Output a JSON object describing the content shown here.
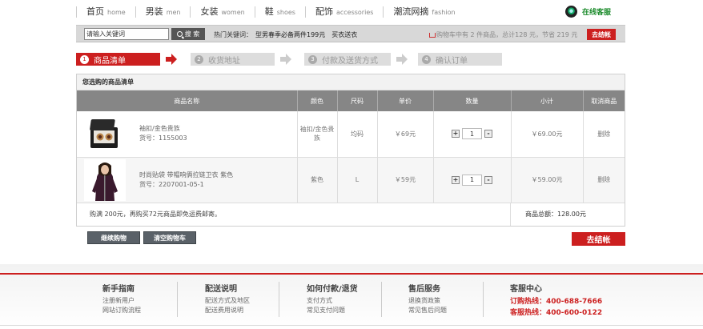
{
  "nav": {
    "items": [
      {
        "zh": "首页",
        "en": "home"
      },
      {
        "zh": "男装",
        "en": "men"
      },
      {
        "zh": "女装",
        "en": "women"
      },
      {
        "zh": "鞋",
        "en": "shoes"
      },
      {
        "zh": "配饰",
        "en": "accessories"
      },
      {
        "zh": "潮流网摘",
        "en": "fashion"
      }
    ],
    "online_service": "在线客服"
  },
  "search": {
    "value": "请输入关键词",
    "button": "搜 索",
    "hot_label": "热门关键词：",
    "hot_links": [
      "型男春季必备两件199元",
      "买衣送衣"
    ]
  },
  "cart_summary": {
    "text": "购物车中有 2 件商品，总计128 元，节省 219 元",
    "checkout": "去结帐"
  },
  "steps": [
    {
      "num": "1",
      "label": "商品清单"
    },
    {
      "num": "2",
      "label": "收货地址"
    },
    {
      "num": "3",
      "label": "付款及送货方式"
    },
    {
      "num": "4",
      "label": "确认订单"
    }
  ],
  "cart": {
    "title": "您选购的商品清单",
    "columns": [
      "商品名称",
      "颜色",
      "尺码",
      "单价",
      "数量",
      "小计",
      "取消商品"
    ],
    "items": [
      {
        "name": "袖扣/金色贵族",
        "sku": "货号：1155003",
        "color": "袖扣/金色贵族",
        "size": "均码",
        "price": "￥69元",
        "qty": "1",
        "subtotal": "￥69.00元",
        "remove": "删除"
      },
      {
        "name": "时尚贴袋 带帽响俩拉链卫衣 紫色",
        "sku": "货号：2207001-05-1",
        "color": "紫色",
        "size": "L",
        "price": "￥59元",
        "qty": "1",
        "subtotal": "￥59.00元",
        "remove": "删除"
      }
    ],
    "free_shipping": "购满 200元，再购买72元商品即免运费邮寄。",
    "total": "商品总额：128.00元",
    "plus": "+",
    "minus": "-"
  },
  "actions": {
    "continue": "继续购物",
    "clear": "清空购物车",
    "checkout": "去结帐"
  },
  "footer": {
    "columns": [
      {
        "title": "新手指南",
        "links": [
          "注册新用户",
          "网站订购流程"
        ]
      },
      {
        "title": "配送说明",
        "links": [
          "配送方式及地区",
          "配送费用说明"
        ]
      },
      {
        "title": "如何付款/退货",
        "links": [
          "支付方式",
          "常见支付问题"
        ]
      },
      {
        "title": "售后服务",
        "links": [
          "退换货政策",
          "常见售后问题"
        ]
      }
    ],
    "service": {
      "title": "客服中心",
      "order_hotline": "订购热线：400-688-7666",
      "service_hotline": "客服热线：400-600-0122"
    }
  }
}
